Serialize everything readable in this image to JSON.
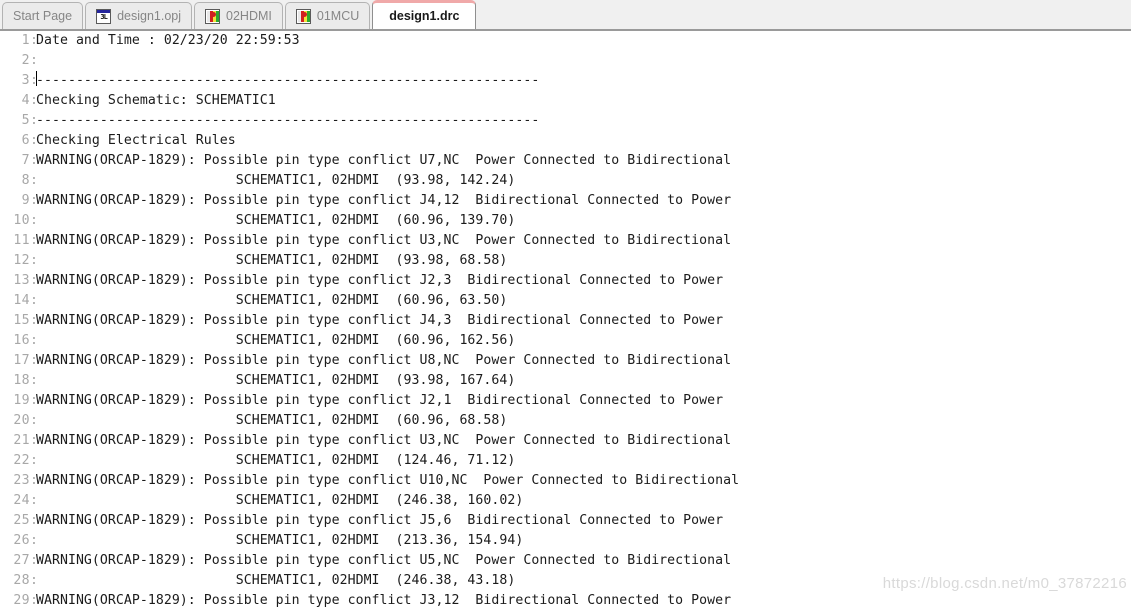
{
  "tabbar": {
    "tabs": [
      {
        "label": "Start Page",
        "icon": "none",
        "active": false
      },
      {
        "label": "design1.opj",
        "icon": "project-icon",
        "active": false
      },
      {
        "label": "02HDMI",
        "icon": "schematic-icon",
        "active": false
      },
      {
        "label": "01MCU",
        "icon": "schematic-icon",
        "active": false
      },
      {
        "label": "design1.drc",
        "icon": "none",
        "active": true
      }
    ]
  },
  "editor": {
    "watermark": "https://blog.csdn.net/m0_37872216",
    "separator": "---------------------------------------------------------------",
    "lines": [
      {
        "n": "1",
        "text": "Date and Time : 02/23/20 22:59:53"
      },
      {
        "n": "2",
        "text": ""
      },
      {
        "n": "3",
        "text": "---------------------------------------------------------------"
      },
      {
        "n": "4",
        "text": "Checking Schematic: SCHEMATIC1"
      },
      {
        "n": "5",
        "text": "---------------------------------------------------------------"
      },
      {
        "n": "6",
        "text": "Checking Electrical Rules"
      },
      {
        "n": "7",
        "text": "WARNING(ORCAP-1829): Possible pin type conflict U7,NC  Power Connected to Bidirectional"
      },
      {
        "n": "8",
        "text": "                         SCHEMATIC1, 02HDMI  (93.98, 142.24)"
      },
      {
        "n": "9",
        "text": "WARNING(ORCAP-1829): Possible pin type conflict J4,12  Bidirectional Connected to Power"
      },
      {
        "n": "10",
        "text": "                         SCHEMATIC1, 02HDMI  (60.96, 139.70)"
      },
      {
        "n": "11",
        "text": "WARNING(ORCAP-1829): Possible pin type conflict U3,NC  Power Connected to Bidirectional"
      },
      {
        "n": "12",
        "text": "                         SCHEMATIC1, 02HDMI  (93.98, 68.58)"
      },
      {
        "n": "13",
        "text": "WARNING(ORCAP-1829): Possible pin type conflict J2,3  Bidirectional Connected to Power"
      },
      {
        "n": "14",
        "text": "                         SCHEMATIC1, 02HDMI  (60.96, 63.50)"
      },
      {
        "n": "15",
        "text": "WARNING(ORCAP-1829): Possible pin type conflict J4,3  Bidirectional Connected to Power"
      },
      {
        "n": "16",
        "text": "                         SCHEMATIC1, 02HDMI  (60.96, 162.56)"
      },
      {
        "n": "17",
        "text": "WARNING(ORCAP-1829): Possible pin type conflict U8,NC  Power Connected to Bidirectional"
      },
      {
        "n": "18",
        "text": "                         SCHEMATIC1, 02HDMI  (93.98, 167.64)"
      },
      {
        "n": "19",
        "text": "WARNING(ORCAP-1829): Possible pin type conflict J2,1  Bidirectional Connected to Power"
      },
      {
        "n": "20",
        "text": "                         SCHEMATIC1, 02HDMI  (60.96, 68.58)"
      },
      {
        "n": "21",
        "text": "WARNING(ORCAP-1829): Possible pin type conflict U3,NC  Power Connected to Bidirectional"
      },
      {
        "n": "22",
        "text": "                         SCHEMATIC1, 02HDMI  (124.46, 71.12)"
      },
      {
        "n": "23",
        "text": "WARNING(ORCAP-1829): Possible pin type conflict U10,NC  Power Connected to Bidirectional"
      },
      {
        "n": "24",
        "text": "                         SCHEMATIC1, 02HDMI  (246.38, 160.02)"
      },
      {
        "n": "25",
        "text": "WARNING(ORCAP-1829): Possible pin type conflict J5,6  Bidirectional Connected to Power"
      },
      {
        "n": "26",
        "text": "                         SCHEMATIC1, 02HDMI  (213.36, 154.94)"
      },
      {
        "n": "27",
        "text": "WARNING(ORCAP-1829): Possible pin type conflict U5,NC  Power Connected to Bidirectional"
      },
      {
        "n": "28",
        "text": "                         SCHEMATIC1, 02HDMI  (246.38, 43.18)"
      },
      {
        "n": "29",
        "text": "WARNING(ORCAP-1829): Possible pin type conflict J3,12  Bidirectional Connected to Power"
      }
    ]
  },
  "colors": {
    "tabbar_bg": "#f0f0f0",
    "active_tab_accent": "#f0a9a9",
    "gutter_text": "#a8a8a8",
    "code_text": "#1b1b1b",
    "watermark": "#d9d9d9"
  }
}
